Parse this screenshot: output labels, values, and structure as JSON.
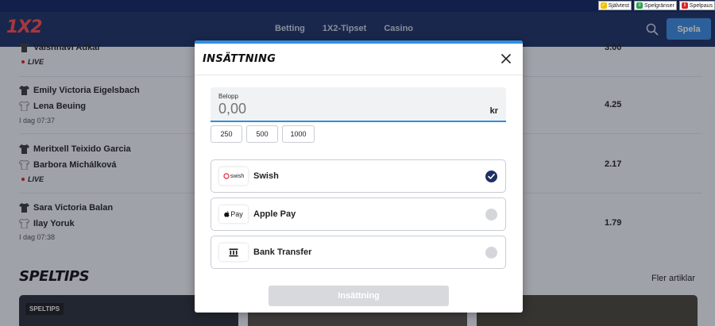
{
  "utility_links": [
    {
      "label": "Självtest",
      "icon": "checklist-icon",
      "color": "#f2c200"
    },
    {
      "label": "Spelgränser",
      "icon": "limits-icon",
      "color": "#2aa24a"
    },
    {
      "label": "Spelpaus",
      "icon": "pause-icon",
      "color": "#d62828"
    }
  ],
  "header": {
    "logo": "1X2",
    "nav": [
      "Betting",
      "1X2-Tipset",
      "Casino"
    ],
    "play_label": "Spela"
  },
  "matches": [
    {
      "players": [
        "Vaishnavi Adkar"
      ],
      "status": "LIVE",
      "odds": "3.00"
    },
    {
      "players": [
        "Emily Victoria Eigelsbach",
        "Lena Beuing"
      ],
      "time": "I dag 07:37",
      "odds": "4.25"
    },
    {
      "players": [
        "Meritxell Teixido Garcia",
        "Barbora Michálková"
      ],
      "status": "LIVE",
      "odds": "2.17"
    },
    {
      "players": [
        "Sara Victoria Balan",
        "Ilay Yoruk"
      ],
      "time": "I dag 07:38",
      "odds": "1.79"
    }
  ],
  "speltips": {
    "title": "SPELTIPS",
    "more": "Fler artiklar",
    "badge": "SPELTIPS"
  },
  "modal": {
    "title": "INSÄTTNING",
    "amount_label": "Belopp",
    "amount_placeholder": "0,00",
    "currency": "kr",
    "quick_amounts": [
      "250",
      "500",
      "1000"
    ],
    "methods": [
      {
        "name": "Swish",
        "logo": "swish",
        "selected": true
      },
      {
        "name": "Apple Pay",
        "logo": "Pay",
        "selected": false
      },
      {
        "name": "Bank Transfer",
        "logo": "bank-icon",
        "selected": false
      }
    ],
    "deposit_label": "Insättning"
  },
  "colors": {
    "brand_navy": "#1e2f63",
    "accent_blue": "#2f8ee3",
    "logo_red": "#ff4b4b",
    "live_red": "#e02020"
  }
}
